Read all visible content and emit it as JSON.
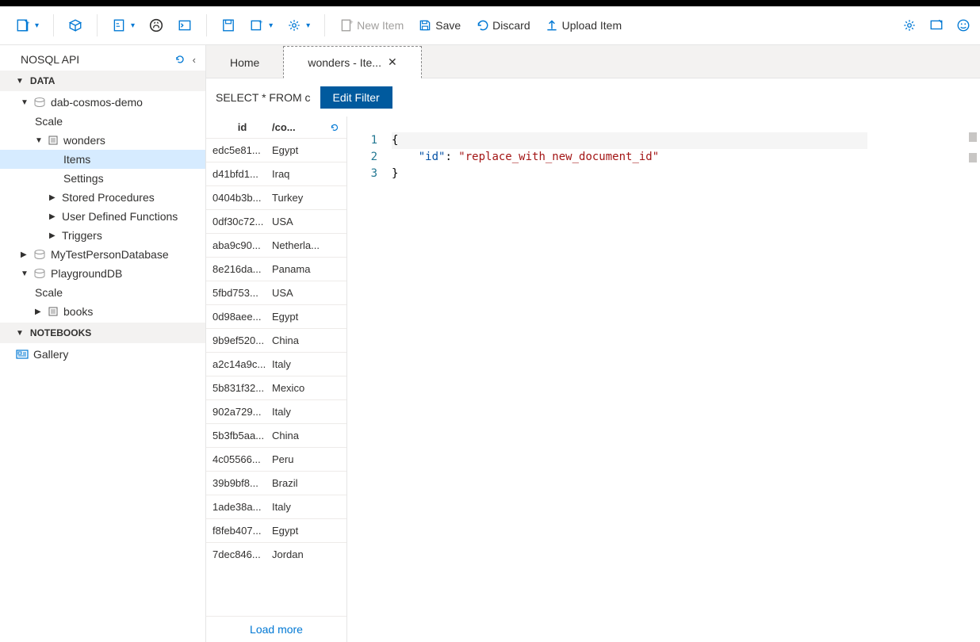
{
  "toolbar": {
    "new_item": "New Item",
    "save": "Save",
    "discard": "Discard",
    "upload": "Upload Item"
  },
  "sidebar": {
    "title": "NOSQL API",
    "section_data": "DATA",
    "section_notebooks": "NOTEBOOKS",
    "db1": "dab-cosmos-demo",
    "db1_scale": "Scale",
    "db1_container": "wonders",
    "items": "Items",
    "settings": "Settings",
    "stored_proc": "Stored Procedures",
    "udf": "User Defined Functions",
    "triggers": "Triggers",
    "db2": "MyTestPersonDatabase",
    "db3": "PlaygroundDB",
    "db3_scale": "Scale",
    "db3_container": "books",
    "gallery": "Gallery"
  },
  "tabs": {
    "home": "Home",
    "active": "wonders - Ite..."
  },
  "filter": {
    "query": "SELECT * FROM c",
    "button": "Edit Filter"
  },
  "list": {
    "col_id": "id",
    "col_co": "/co...",
    "load_more": "Load more",
    "rows": [
      {
        "id": "edc5e81...",
        "co": "Egypt"
      },
      {
        "id": "d41bfd1...",
        "co": "Iraq"
      },
      {
        "id": "0404b3b...",
        "co": "Turkey"
      },
      {
        "id": "0df30c72...",
        "co": "USA"
      },
      {
        "id": "aba9c90...",
        "co": "Netherla..."
      },
      {
        "id": "8e216da...",
        "co": "Panama"
      },
      {
        "id": "5fbd753...",
        "co": "USA"
      },
      {
        "id": "0d98aee...",
        "co": "Egypt"
      },
      {
        "id": "9b9ef520...",
        "co": "China"
      },
      {
        "id": "a2c14a9c...",
        "co": "Italy"
      },
      {
        "id": "5b831f32...",
        "co": "Mexico"
      },
      {
        "id": "902a729...",
        "co": "Italy"
      },
      {
        "id": "5b3fb5aa...",
        "co": "China"
      },
      {
        "id": "4c05566...",
        "co": "Peru"
      },
      {
        "id": "39b9bf8...",
        "co": "Brazil"
      },
      {
        "id": "1ade38a...",
        "co": "Italy"
      },
      {
        "id": "f8feb407...",
        "co": "Egypt"
      },
      {
        "id": "7dec846...",
        "co": "Jordan"
      }
    ]
  },
  "editor": {
    "lines": [
      "1",
      "2",
      "3"
    ],
    "brace_open": "{",
    "key": "\"id\"",
    "colon": ": ",
    "value": "\"replace_with_new_document_id\"",
    "brace_close": "}"
  }
}
